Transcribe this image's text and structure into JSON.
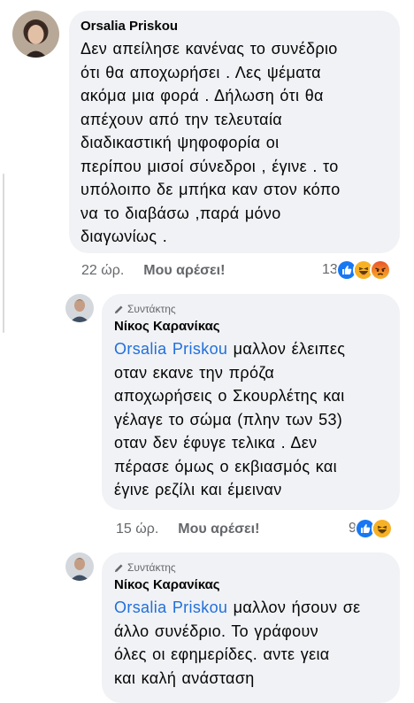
{
  "comments": [
    {
      "author": "Orsalia Priskou",
      "badge": "",
      "mention": "",
      "lines": [
        "Δεν απείλησε κανένας το συνέδριο",
        "ότι θα αποχωρήσει . Λες ψέματα",
        "ακόμα μια φορά . Δήλωση ότι θα",
        "απέχουν από την τελευταία",
        "διαδικαστική ψηφοφορία οι",
        "περίπου μισοί σύνεδροι , έγινε . το",
        "υπόλοιπο δε μπήκα καν στον κόπο",
        "να το διαβάσω ,παρά μόνο",
        "διαγωνίως ."
      ],
      "time": "22 ώρ.",
      "like_label": "Μου αρέσει!",
      "reaction_count": "13",
      "reactions": [
        "like-icon",
        "haha-icon",
        "angry-icon"
      ]
    },
    {
      "author": "Νίκος Καρανίκας",
      "badge": "Συντάκτης",
      "mention": "Orsalia Priskou",
      "lines": [
        " μαλλον έλειπες",
        "οταν εκανε την πρόζα",
        "αποχωρήσεις ο Σκουρλέτης και",
        "γέλαγε το σώμα (πλην των 53)",
        "οταν δεν έφυγε τελικα . Δεν",
        "πέρασε όμως ο εκβιασμός και",
        "έγινε ρεζίλι και έμειναν"
      ],
      "time": "15 ώρ.",
      "like_label": "Μου αρέσει!",
      "reaction_count": "9",
      "reactions": [
        "like-icon",
        "haha-icon"
      ]
    },
    {
      "author": "Νίκος Καρανίκας",
      "badge": "Συντάκτης",
      "mention": "Orsalia Priskou",
      "lines": [
        " μαλλον ήσουν σε",
        "άλλο συνέδριο.  Το γράφουν",
        "όλες οι εφημερίδες. αντε γεια",
        "και καλή ανάσταση"
      ]
    }
  ]
}
